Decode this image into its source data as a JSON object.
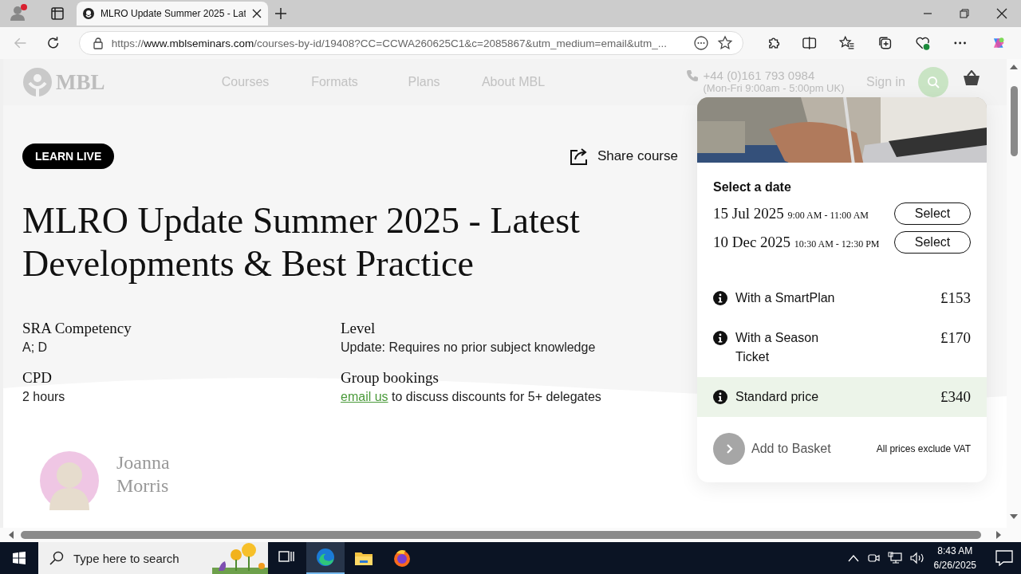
{
  "browser": {
    "tab": {
      "title": "MLRO Update Summer 2025 - Lat",
      "selected": true
    },
    "url": {
      "scheme": "https://",
      "host": "www.mblseminars.com",
      "path": "/courses-by-id/19408?CC=CCWA260625C1&c=2085867&utm_medium=email&utm_..."
    }
  },
  "site_header": {
    "logo": "MBL",
    "nav": [
      "Courses",
      "Formats",
      "Plans",
      "About MBL"
    ],
    "phone": "+44 (0)161 793 0984",
    "hours": "(Mon-Fri 9:00am - 5:00pm UK)",
    "sign_in": "Sign in"
  },
  "course": {
    "badge": "LEARN LIVE",
    "share": "Share course",
    "title": "MLRO Update Summer 2025 - Latest Developments & Best Practice",
    "details": [
      {
        "kind": "text",
        "label": "SRA Competency",
        "value": "A; D"
      },
      {
        "kind": "text",
        "label": "Level",
        "value": "Update: Requires no prior subject knowledge"
      },
      {
        "kind": "text",
        "label": "CPD",
        "value": "2 hours"
      },
      {
        "kind": "link",
        "label": "Group bookings",
        "link": "email us",
        "value": " to discuss discounts for 5+ delegates"
      }
    ]
  },
  "presenter": {
    "name": "Joanna Morris"
  },
  "booking": {
    "heading": "Select a date",
    "dates": [
      {
        "date": "15 Jul 2025",
        "time": "9:00 AM - 11:00 AM",
        "button": "Select"
      },
      {
        "date": "10 Dec 2025",
        "time": "10:30 AM - 12:30 PM",
        "button": "Select"
      }
    ],
    "prices": [
      {
        "label": "With a SmartPlan",
        "price": "£153",
        "selected": false
      },
      {
        "label": "With a Season Ticket",
        "price": "£170",
        "selected": false
      },
      {
        "label": "Standard price",
        "price": "£340",
        "selected": true
      }
    ],
    "add_to_basket": "Add to Basket",
    "vat_note": "All prices exclude VAT"
  },
  "taskbar": {
    "search_placeholder": "Type here to search",
    "apps": [
      {
        "kind": "task-view",
        "selected": false
      },
      {
        "kind": "edge",
        "selected": true
      },
      {
        "kind": "explorer",
        "selected": false
      },
      {
        "kind": "firefox",
        "selected": false
      }
    ],
    "time": "8:43 AM",
    "date": "6/26/2025"
  }
}
